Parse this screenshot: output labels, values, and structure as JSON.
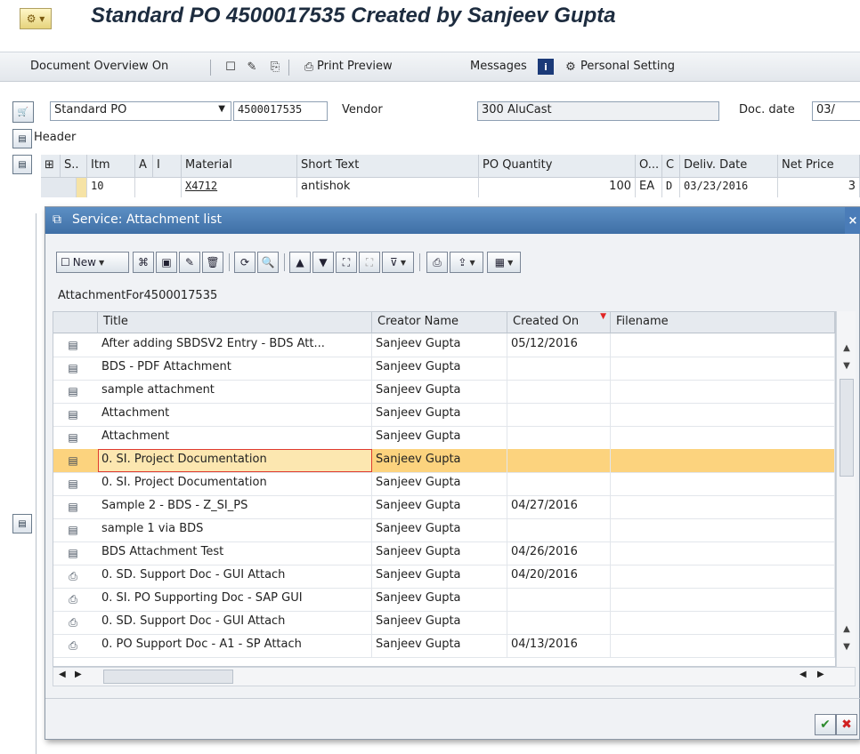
{
  "window": {
    "title": "Standard PO 4500017535 Created by Sanjeev Gupta"
  },
  "toolbar": {
    "document_overview": "Document Overview On",
    "print_preview": "Print Preview",
    "messages": "Messages",
    "personal_setting": "Personal Setting"
  },
  "header": {
    "doc_type": "Standard PO",
    "po_number": "4500017535",
    "vendor_label": "Vendor",
    "vendor_value": "300 AluCast",
    "doc_date_label": "Doc. date",
    "doc_date_value": "03/",
    "header_label": "Header"
  },
  "items_table": {
    "columns": [
      "S..",
      "Itm",
      "A",
      "I",
      "Material",
      "Short Text",
      "PO Quantity",
      "O...",
      "C",
      "Deliv. Date",
      "Net Price"
    ],
    "row": {
      "item": "10",
      "material": "X4712",
      "short_text": "antishok",
      "quantity": "100",
      "unit": "EA",
      "cat": "D",
      "deliv_date": "03/23/2016",
      "net_price": "3"
    }
  },
  "dialog": {
    "title": "Service: Attachment list",
    "new_button": "New",
    "list_caption": "AttachmentFor4500017535",
    "columns": {
      "title": "Title",
      "creator": "Creator Name",
      "created_on": "Created On",
      "filename": "Filename"
    },
    "rows": [
      {
        "title": "After adding SBDSV2 Entry - BDS Att...",
        "creator": "Sanjeev Gupta",
        "created_on": "05/12/2016",
        "filename": "",
        "icon": "document-icon"
      },
      {
        "title": "BDS - PDF Attachment",
        "creator": "Sanjeev Gupta",
        "created_on": "",
        "filename": "",
        "icon": "document-icon"
      },
      {
        "title": "sample attachment",
        "creator": "Sanjeev Gupta",
        "created_on": "",
        "filename": "",
        "icon": "document-icon"
      },
      {
        "title": "Attachment",
        "creator": "Sanjeev Gupta",
        "created_on": "",
        "filename": "",
        "icon": "document-icon"
      },
      {
        "title": "Attachment",
        "creator": "Sanjeev Gupta",
        "created_on": "",
        "filename": "",
        "icon": "document-icon"
      },
      {
        "title": "0. SI. Project Documentation",
        "creator": "Sanjeev Gupta",
        "created_on": "",
        "filename": "",
        "icon": "document-icon",
        "selected": true
      },
      {
        "title": "0. SI. Project Documentation",
        "creator": "Sanjeev Gupta",
        "created_on": "",
        "filename": "",
        "icon": "document-icon"
      },
      {
        "title": "Sample 2 - BDS - Z_SI_PS",
        "creator": "Sanjeev Gupta",
        "created_on": "04/27/2016",
        "filename": "",
        "icon": "document-icon"
      },
      {
        "title": "sample 1 via BDS",
        "creator": "Sanjeev Gupta",
        "created_on": "",
        "filename": "",
        "icon": "document-icon"
      },
      {
        "title": "BDS Attachment Test",
        "creator": "Sanjeev Gupta",
        "created_on": "04/26/2016",
        "filename": "",
        "icon": "document-icon"
      },
      {
        "title": "0. SD. Support Doc - GUI Attach",
        "creator": "Sanjeev Gupta",
        "created_on": "04/20/2016",
        "filename": "",
        "icon": "paperclip-icon"
      },
      {
        "title": "0. SI. PO Supporting Doc - SAP GUI",
        "creator": "Sanjeev Gupta",
        "created_on": "",
        "filename": "",
        "icon": "paperclip-icon"
      },
      {
        "title": "0. SD. Support Doc - GUI Attach",
        "creator": "Sanjeev Gupta",
        "created_on": "",
        "filename": "",
        "icon": "paperclip-icon"
      },
      {
        "title": "0. PO Support Doc - A1 - SP Attach",
        "creator": "Sanjeev Gupta",
        "created_on": "04/13/2016",
        "filename": "",
        "icon": "paperclip-icon"
      }
    ]
  },
  "colors": {
    "title_text": "#1d2c3f",
    "dialog_titlebar": "#4a7cb8",
    "selected_row": "#fcd37e",
    "ok_green": "#2e8b2e",
    "cancel_red": "#d12020"
  }
}
